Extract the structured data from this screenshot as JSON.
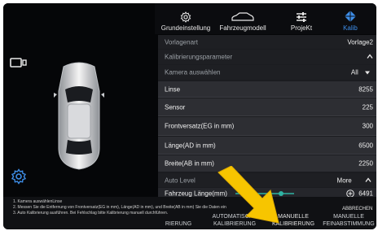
{
  "toolbar": {
    "items": [
      {
        "label": "Grundeinstellung",
        "icon": "gear-icon"
      },
      {
        "label": "Fahrzeugmodell",
        "icon": "car-outline-icon"
      },
      {
        "label": "ProjeKt",
        "icon": "sliders-icon"
      },
      {
        "label": "Kalib",
        "icon": "crosshair-icon"
      }
    ]
  },
  "panel": {
    "vorlagenart_label": "Vorlagenart",
    "vorlagenart_value": "Vorlage2",
    "kalib_param_label": "Kalibrierungsparameter",
    "kamera_label": "Kamera auswählen",
    "kamera_value": "All",
    "linse_label": "Linse",
    "linse_value": "8255",
    "sensor_label": "Sensor",
    "sensor_value": "225",
    "frontversatz_label": "Frontversatz(EG in mm)",
    "frontversatz_value": "300",
    "laenge_label": "Länge(AD in mm)",
    "laenge_value": "6500",
    "breite_label": "Breite(AB in mm)",
    "breite_value": "2250",
    "autolevel_label": "Auto Level",
    "more_label": "More",
    "fahrzeug_label": "Fahrzeug Länge(mm)",
    "fahrzeug_value": "6491"
  },
  "bottom": {
    "hint1": "1. Kamera auswählenLinse",
    "hint2": "2. Messen Sie die Entfernung von Frontversatz(EG in mm), Länge(AD in mm), und Breite(AB in mm) Sie die Daten ein",
    "hint3": "3. Auto Kalibrierung ausführen. Bei Fehlschlag bitte Kalibrierung manuell durchführen.",
    "next_label": "ABBRECHEN",
    "tab1": "RIERUNG",
    "tab2a": "AUTOMATISCHE",
    "tab2b": "KALIBRIERUNG",
    "tab3a": "MANUELLE",
    "tab3b": "KALIBRIERUNG",
    "tab4a": "MANUELLE",
    "tab4b": "FEINABSTIMMUNG"
  },
  "colors": {
    "accent": "#2e8cf0",
    "arrow": "#f7c500",
    "slider": "#2fb3a3"
  }
}
